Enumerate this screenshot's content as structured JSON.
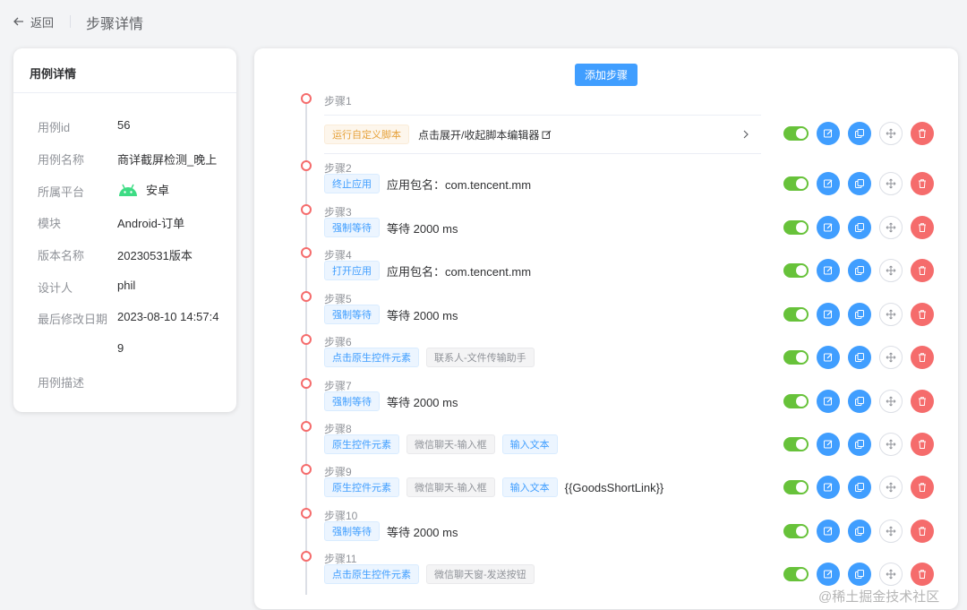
{
  "header": {
    "back_label": "返回",
    "title": "步骤详情"
  },
  "case": {
    "title": "用例详情",
    "fields": [
      {
        "key": "用例id",
        "value": "56"
      },
      {
        "key": "用例名称",
        "value": "商详截屏检测_晚上"
      },
      {
        "key": "所属平台",
        "value": "安卓",
        "icon": "android-icon"
      },
      {
        "key": "模块",
        "value": "Android-订单"
      },
      {
        "key": "版本名称",
        "value": "20230531版本"
      },
      {
        "key": "设计人",
        "value": "phil"
      },
      {
        "key": "最后修改日期",
        "value": "2023-08-10 14:57:4",
        "value_cont": "9"
      },
      {
        "key": "用例描述",
        "value": ""
      }
    ]
  },
  "main": {
    "add_step_label": "添加步骤",
    "steps": [
      {
        "title": "步骤1",
        "tags": [
          {
            "text": "运行自定义脚本",
            "style": "orange"
          }
        ],
        "script_toggle": "点击展开/收起脚本编辑器"
      },
      {
        "title": "步骤2",
        "tags": [
          {
            "text": "终止应用",
            "style": "blue"
          }
        ],
        "text": "应用包名：com.tencent.mm"
      },
      {
        "title": "步骤3",
        "tags": [
          {
            "text": "强制等待",
            "style": "blue"
          }
        ],
        "text": "等待 2000 ms"
      },
      {
        "title": "步骤4",
        "tags": [
          {
            "text": "打开应用",
            "style": "blue"
          }
        ],
        "text": "应用包名：com.tencent.mm"
      },
      {
        "title": "步骤5",
        "tags": [
          {
            "text": "强制等待",
            "style": "blue"
          }
        ],
        "text": "等待 2000 ms"
      },
      {
        "title": "步骤6",
        "tags": [
          {
            "text": "点击原生控件元素",
            "style": "blue"
          },
          {
            "text": "联系人-文件传输助手",
            "style": "gray"
          }
        ]
      },
      {
        "title": "步骤7",
        "tags": [
          {
            "text": "强制等待",
            "style": "blue"
          }
        ],
        "text": "等待 2000 ms"
      },
      {
        "title": "步骤8",
        "tags": [
          {
            "text": "原生控件元素",
            "style": "blue"
          },
          {
            "text": "微信聊天-输入框",
            "style": "gray"
          },
          {
            "text": "输入文本",
            "style": "blue"
          }
        ]
      },
      {
        "title": "步骤9",
        "tags": [
          {
            "text": "原生控件元素",
            "style": "blue"
          },
          {
            "text": "微信聊天-输入框",
            "style": "gray"
          },
          {
            "text": "输入文本",
            "style": "blue"
          }
        ],
        "text": "{{GoodsShortLink}}"
      },
      {
        "title": "步骤10",
        "tags": [
          {
            "text": "强制等待",
            "style": "blue"
          }
        ],
        "text": "等待 2000 ms"
      },
      {
        "title": "步骤11",
        "tags": [
          {
            "text": "点击原生控件元素",
            "style": "blue"
          },
          {
            "text": "微信聊天窗-发送按钮",
            "style": "gray"
          }
        ]
      }
    ]
  },
  "watermark": "@稀土掘金技术社区",
  "colors": {
    "primary": "#409eff",
    "danger": "#f56c6c",
    "success": "#67c23a",
    "warning": "#e6a23c"
  }
}
